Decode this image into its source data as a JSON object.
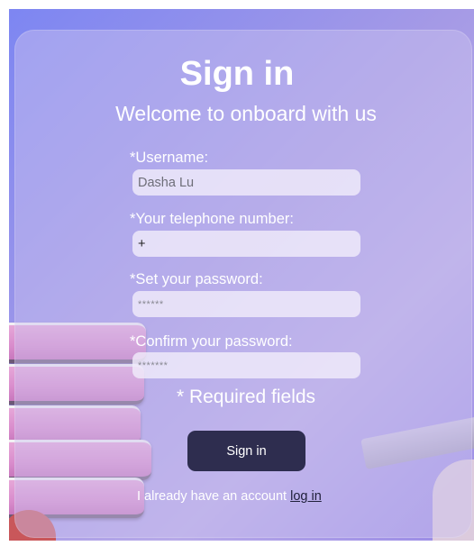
{
  "header": {
    "title": "Sign in",
    "subtitle": "Welcome to onboard with us"
  },
  "form": {
    "username": {
      "label": "*Username:",
      "value": "Dasha Lu"
    },
    "telephone": {
      "label": "*Your telephone number:",
      "value": "+"
    },
    "password": {
      "label": "*Set your password:",
      "value": "******"
    },
    "confirm_password": {
      "label": "*Confirm your password:",
      "value": "*******"
    },
    "required_note": "* Required fields",
    "submit_label": "Sign in"
  },
  "footer": {
    "account_text": "I already have an account",
    "login_link": "log in"
  },
  "colors": {
    "button": "#2e2d4f",
    "background_accent": "#7d86f2"
  }
}
